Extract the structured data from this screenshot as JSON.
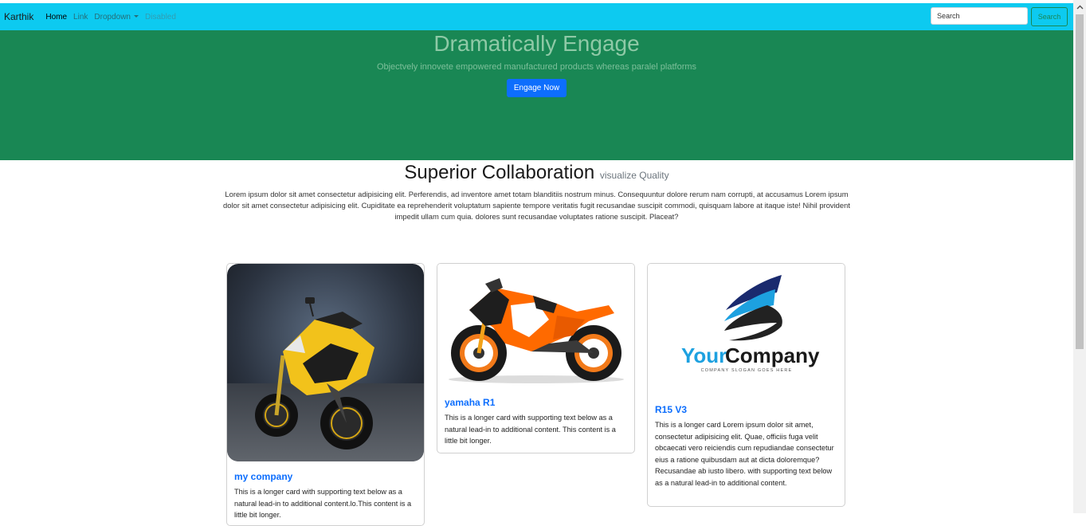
{
  "navbar": {
    "brand": "Karthik",
    "links": [
      {
        "label": "Home",
        "state": "active"
      },
      {
        "label": "Link",
        "state": "normal"
      },
      {
        "label": "Dropdown",
        "state": "normal"
      },
      {
        "label": "Disabled",
        "state": "disabled"
      }
    ],
    "search_placeholder": "Search",
    "search_button": "Search"
  },
  "hero": {
    "title": "Dramatically Engage",
    "subtitle": "Objectvely innovete empowered manufactured products whereas paralel platforms",
    "button": "Engage Now"
  },
  "section": {
    "title": "Superior Collaboration",
    "muted": "visualize Quality",
    "text": "Lorem ipsum dolor sit amet consectetur adipisicing elit. Perferendis, ad inventore amet totam blanditiis nostrum minus. Consequuntur dolore rerum nam corrupti, at accusamus Lorem ipsum dolor sit amet consectetur adipisicing elit. Cupiditate ea reprehenderit voluptatum sapiente tempore veritatis fugit recusandae suscipit commodi, quisquam labore at itaque iste! Nihil provident impedit ullam cum quia. dolores sunt recusandae voluptates ratione suscipit. Placeat?"
  },
  "cards": [
    {
      "image": "yellow-sport-motorcycle",
      "title": "my company",
      "text": "This is a longer card with supporting text below as a natural lead-in to additional content.lo.This content is a little bit longer."
    },
    {
      "image": "orange-ktm-rc-motorcycle",
      "title": "yamaha R1",
      "text": "This is a longer card with supporting text below as a natural lead-in to additional content. This content is a little bit longer."
    },
    {
      "image": "your-company-logo",
      "logo_text_a": "Your",
      "logo_text_b": "Company",
      "logo_slogan": "COMPANY SLOGAN GOES HERE",
      "title": "R15 V3",
      "text": "This is a longer card Lorem ipsum dolor sit amet, consectetur adipisicing elit. Quae, officiis fuga velit obcaecati vero reiciendis cum repudiandae consectetur eius a ratione quibusdam aut at dicta doloremque? Recusandae ab iusto libero. with supporting text below as a natural lead-in to additional content."
    }
  ],
  "colors": {
    "navbar": "#0dcaf0",
    "hero": "#198754",
    "primary": "#0d6efd",
    "success": "#198754"
  }
}
